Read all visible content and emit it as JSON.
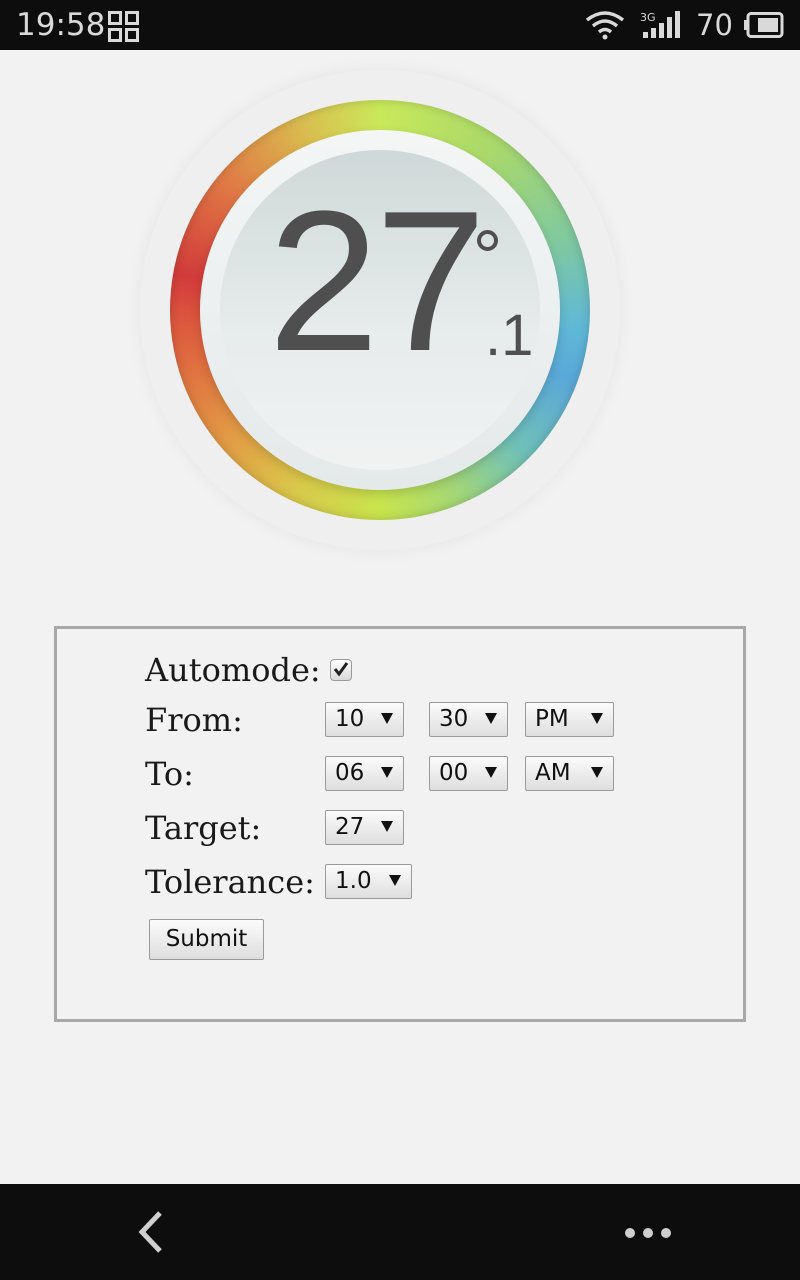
{
  "status_bar": {
    "time": "19:58",
    "battery_level": "70",
    "network": "3G",
    "icons": [
      "grid-icon",
      "wifi-icon",
      "signal-icon",
      "battery-icon"
    ]
  },
  "gauge": {
    "temperature_whole": "27",
    "temperature_decimal": ".1",
    "unit_symbol": "degree"
  },
  "form": {
    "automode": {
      "label": "Automode:",
      "checked": true
    },
    "from": {
      "label": "From:",
      "hour": "10",
      "minute": "30",
      "period": "PM"
    },
    "to": {
      "label": "To:",
      "hour": "06",
      "minute": "00",
      "period": "AM"
    },
    "target": {
      "label": "Target:",
      "value": "27"
    },
    "tolerance": {
      "label": "Tolerance:",
      "value": "1.0"
    },
    "submit_label": "Submit"
  },
  "nav_bar": {
    "icons": [
      "back-icon",
      "more-icon"
    ]
  },
  "colors": {
    "status_bar_bg": "#0d0d0d",
    "page_bg": "#f2f2f2",
    "temperature_text": "#4f4f4f",
    "panel_border": "#a9a9a9"
  }
}
